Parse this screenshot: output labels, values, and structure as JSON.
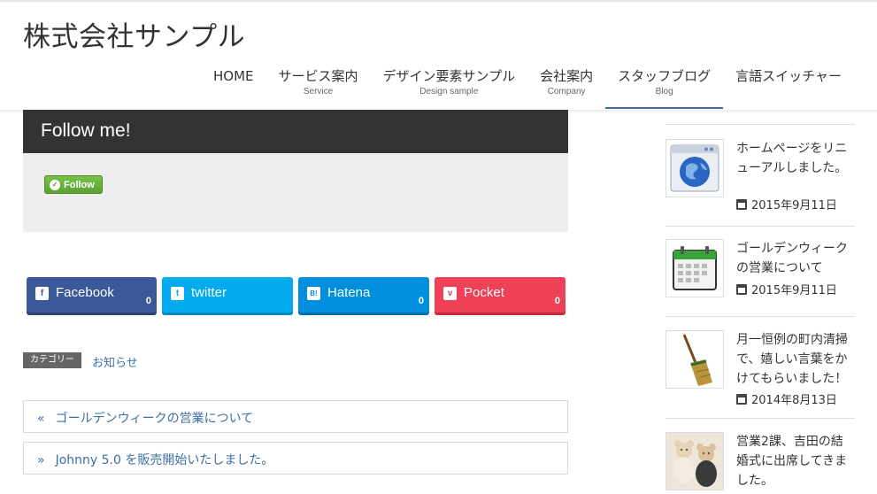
{
  "site": {
    "title": "株式会社サンプル"
  },
  "nav": [
    {
      "label": "HOME",
      "sub": ""
    },
    {
      "label": "サービス案内",
      "sub": "Service"
    },
    {
      "label": "デザイン要素サンプル",
      "sub": "Design sample"
    },
    {
      "label": "会社案内",
      "sub": "Company"
    },
    {
      "label": "スタッフブログ",
      "sub": "Blog"
    },
    {
      "label": "言語スイッチャー",
      "sub": ""
    }
  ],
  "follow": {
    "heading": "Follow me!",
    "button_label": "Follow"
  },
  "share": [
    {
      "label": "Facebook",
      "icon": "f",
      "count": "0",
      "color": "#3b5998"
    },
    {
      "label": "twitter",
      "icon": "t",
      "count": "",
      "color": "#00acee"
    },
    {
      "label": "Hatena",
      "icon": "B!",
      "count": "0",
      "color": "#008fde"
    },
    {
      "label": "Pocket",
      "icon": "v",
      "count": "0",
      "color": "#ee4056"
    }
  ],
  "category": {
    "badge": "カテゴリー",
    "link": "お知らせ"
  },
  "post_nav": {
    "prev_arrow": "«",
    "prev": "ゴールデンウィークの営業について",
    "next_arrow": "»",
    "next": "Johnny 5.0 を販売開始いたしました。"
  },
  "sidebar": [
    {
      "title": "ホームページをリニューアルしました。",
      "date": "2015年9月11日",
      "thumb": "globe-browser-icon"
    },
    {
      "title": "ゴールデンウィークの営業について",
      "date": "2015年9月11日",
      "thumb": "calendar-icon"
    },
    {
      "title": "月一恒例の町内清掃で、嬉しい言葉をかけてもらいました！",
      "date": "2014年8月13日",
      "thumb": "broom-icon"
    },
    {
      "title": "営業2課、吉田の結婚式に出席してきました。",
      "date": "",
      "thumb": "teddy-bears-photo"
    }
  ]
}
